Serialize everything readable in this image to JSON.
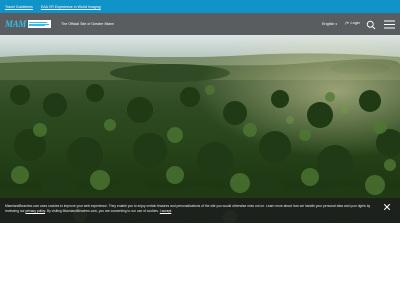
{
  "topbar": {
    "links": [
      "Travel Guidelines",
      "EAA VR Experience in World Imaging"
    ]
  },
  "header": {
    "logo_text": "MAM",
    "tagline": "The Official Site of Greater Miami",
    "language": "English",
    "login": "Login",
    "icons": [
      "search-icon",
      "hamburger-menu-icon",
      "person-icon",
      "chevron-down-icon"
    ]
  },
  "hero": {
    "image": "aerial view of palm forest at sunrise"
  },
  "cookie_banner": {
    "text_1": "MiamiandBeaches.com uses cookies to improve your web experience. They enable you to enjoy certain features and personalizations of the site you would otherwise miss out on. Learn more about how we handle your personal data and your rights by reviewing our ",
    "privacy_link": "privacy policy",
    "text_2": ". By visiting MiamiandBeaches.com, you are consenting to our use of cookies. ",
    "accept_link": "I accept",
    "close_icon": "close-icon"
  },
  "colors": {
    "topbar": "#0f93c8",
    "header": "#5a5d60",
    "logo_accent": "#2fc0ea",
    "cookie_bg": "#1c1e1e"
  }
}
